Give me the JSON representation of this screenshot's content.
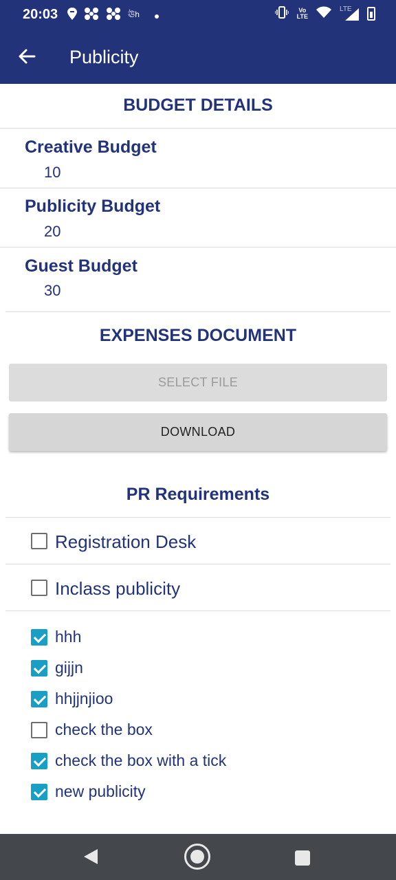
{
  "status_bar": {
    "time": "20:03",
    "left_icons": [
      "swiggy-icon",
      "connectivity-icon",
      "connectivity-icon",
      "app-icon",
      "dot-icon"
    ],
    "right_icons": [
      "vibrate-icon",
      "volte-icon",
      "wifi-icon",
      "lte-signal-icon",
      "battery-icon"
    ],
    "lte_label": "LTE",
    "app_label": "ঊh",
    "volte_label": "Vo\nLTE"
  },
  "app_bar": {
    "title": "Publicity",
    "back_icon": "arrow-left-icon"
  },
  "budget": {
    "title": "BUDGET DETAILS",
    "items": [
      {
        "label": "Creative Budget",
        "value": "10"
      },
      {
        "label": "Publicity Budget",
        "value": "20"
      },
      {
        "label": "Guest Budget",
        "value": "30"
      }
    ]
  },
  "expenses": {
    "title": "EXPENSES DOCUMENT",
    "select_label": "SELECT FILE",
    "download_label": "DOWNLOAD"
  },
  "pr": {
    "title": "PR Requirements",
    "primary": [
      {
        "label": "Registration Desk",
        "checked": false
      },
      {
        "label": "Inclass publicity",
        "checked": false
      }
    ],
    "extras": [
      {
        "label": "hhh",
        "checked": true
      },
      {
        "label": "gijjn",
        "checked": true
      },
      {
        "label": "hhjjnjioo",
        "checked": true
      },
      {
        "label": "check the box",
        "checked": false
      },
      {
        "label": "check the box with a tick",
        "checked": true
      },
      {
        "label": "new publicity",
        "checked": true
      }
    ]
  },
  "colors": {
    "primary": "#22337a",
    "checkbox_checked": "#1a9fc4",
    "navbar": "#44474b"
  }
}
